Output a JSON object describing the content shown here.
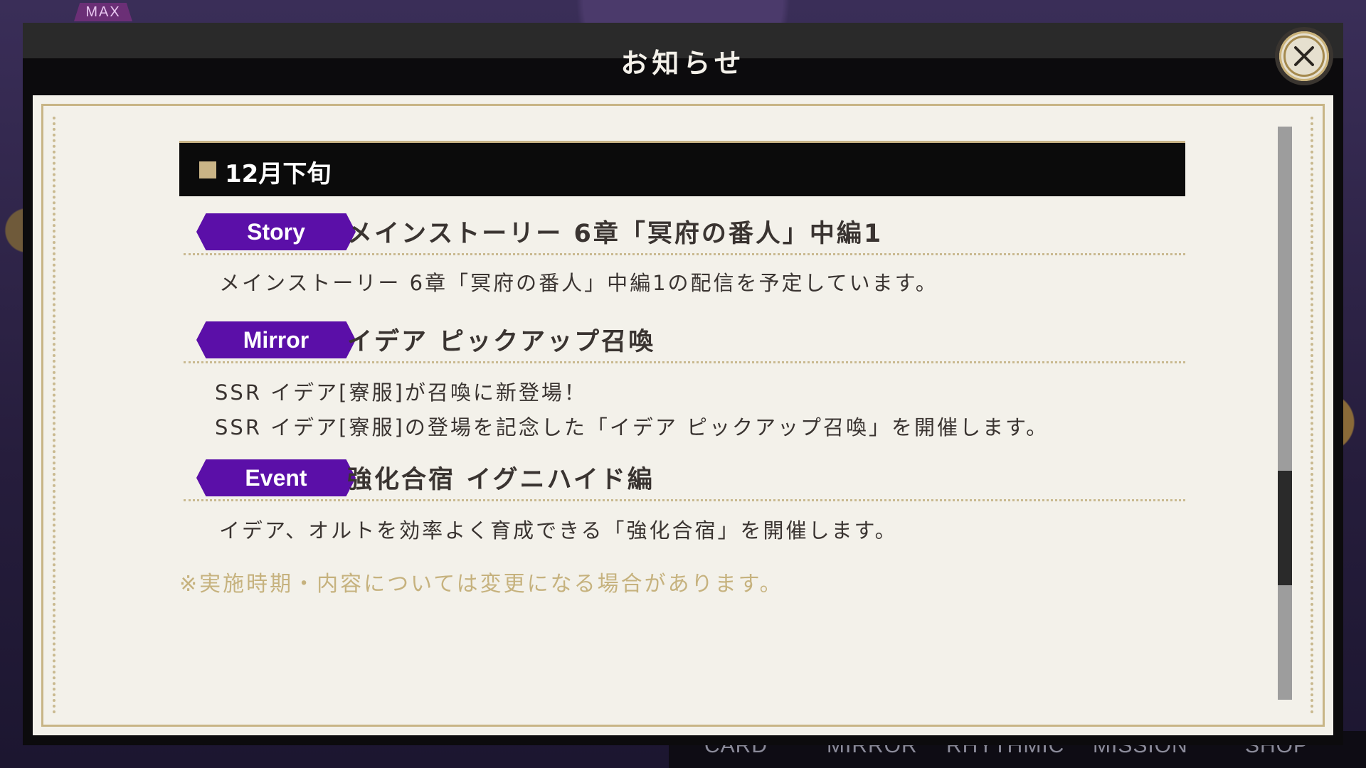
{
  "background": {
    "max_badge": "MAX",
    "bottom_nav": [
      "CARD",
      "MIRROR",
      "RHYTHMIC",
      "MISSION",
      "SHOP"
    ]
  },
  "dialog": {
    "title": "お知らせ",
    "close_icon": "close-icon"
  },
  "notice": {
    "section_label": "12月下旬",
    "entries": [
      {
        "tag": "Story",
        "title": "メインストーリー 6章「冥府の番人」中編1",
        "body": [
          "メインストーリー 6章「冥府の番人」中編1の配信を予定しています。"
        ]
      },
      {
        "tag": "Mirror",
        "title": "イデア ピックアップ召喚",
        "body": [
          "SSR イデア[寮服]が召喚に新登場！",
          "SSR イデア[寮服]の登場を記念した「イデア ピックアップ召喚」を開催します。"
        ]
      },
      {
        "tag": "Event",
        "title": "強化合宿 イグニハイド編",
        "body": [
          "イデア、オルトを効率よく育成できる「強化合宿」を開催します。"
        ]
      }
    ],
    "footnote": "※実施時期・内容については変更になる場合があります。"
  },
  "scrollbar": {
    "thumb_start": 0.6,
    "thumb_end": 0.8
  },
  "colors": {
    "tag_purple": "#5b0fa8",
    "gold": "#c9b486",
    "paper": "#f3f1ea"
  }
}
